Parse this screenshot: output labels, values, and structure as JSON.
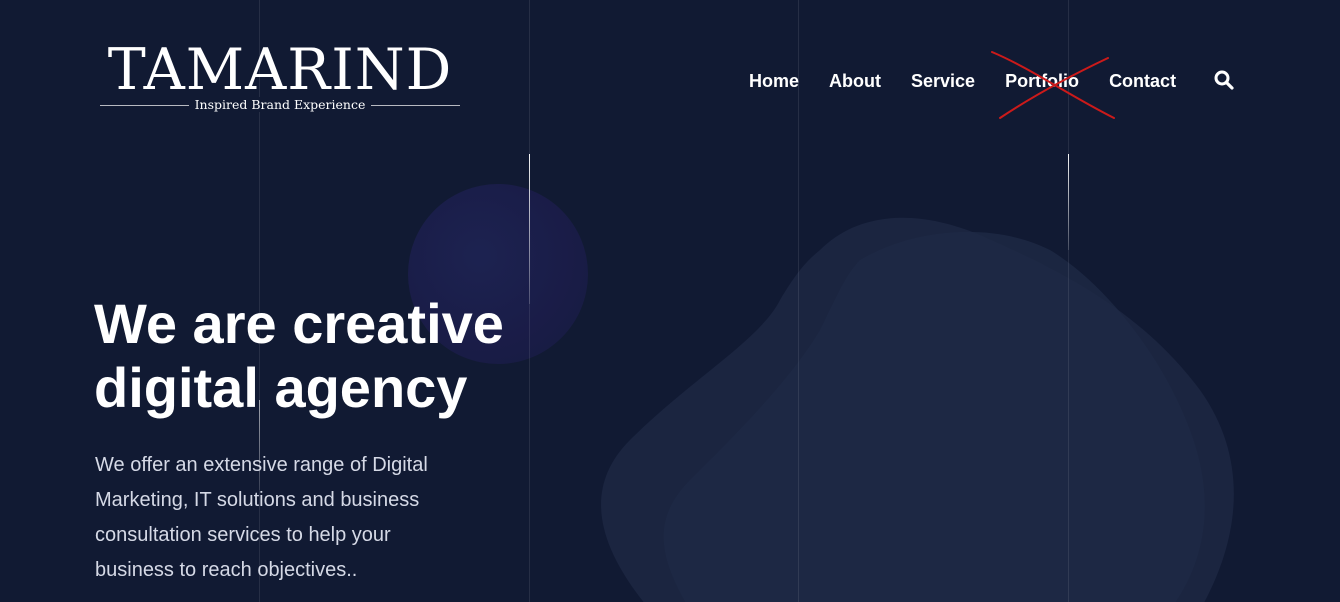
{
  "brand": {
    "logo_text": "TAMARIND",
    "tagline": "Inspired Brand Experience"
  },
  "nav": {
    "items": [
      {
        "label": "Home"
      },
      {
        "label": "About"
      },
      {
        "label": "Service"
      },
      {
        "label": "Portfolio",
        "struck_out": true
      },
      {
        "label": "Contact"
      }
    ],
    "search_icon": "search-icon",
    "strike_color": "#cc1a1a"
  },
  "hero": {
    "title_line1": "We are creative",
    "title_line2": "digital agency",
    "text_lines": [
      "We offer an extensive range of Digital",
      "Marketing, IT solutions and business",
      "consultation services to help your",
      "business to reach objectives.."
    ]
  },
  "colors": {
    "background": "#111a33",
    "blob": "#1b2540",
    "text": "#ffffff",
    "body_text": "#d5d9e6"
  }
}
